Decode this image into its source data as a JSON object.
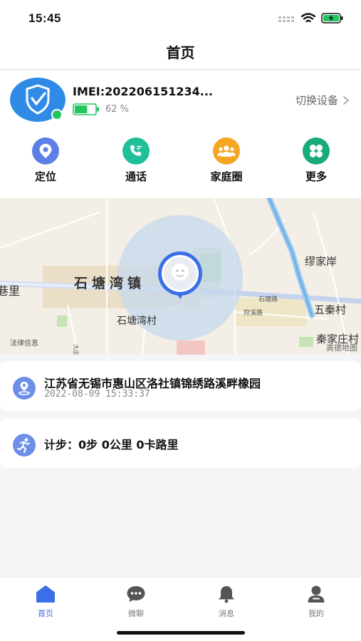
{
  "status_bar": {
    "time": "15:45"
  },
  "nav": {
    "title": "首页"
  },
  "device": {
    "imei": "IMEI:202206151234...",
    "battery_percent_text": "62 %",
    "battery_level": 0.62,
    "switch_label": "切换设备"
  },
  "quick_actions": [
    {
      "label": "定位",
      "icon": "location-pin-icon",
      "color": "#5b7fe6"
    },
    {
      "label": "通话",
      "icon": "phone-call-icon",
      "color": "#1fbf9a"
    },
    {
      "label": "家庭圈",
      "icon": "family-group-icon",
      "color": "#f5a623"
    },
    {
      "label": "更多",
      "icon": "more-grid-icon",
      "color": "#1aab7a"
    }
  ],
  "map": {
    "labels": {
      "town": "石塘湾镇",
      "village": "石塘湾村",
      "left_edge": "巷里",
      "miaojiaan": "缪家岸",
      "wuqin": "五秦村",
      "qinjiazhuang": "秦家庄村",
      "road1": "石塘路",
      "road2": "狩溪路",
      "road3": "大庄路",
      "legal": "法律信息",
      "provider": "高德地图"
    }
  },
  "location": {
    "address": "江苏省无锡市惠山区洛社镇锦绣路溪畔橡园",
    "time": "2022-08-09 15:33:37"
  },
  "steps": {
    "text": "计步：0步 0公里 0卡路里"
  },
  "tabs": [
    {
      "label": "首页",
      "icon": "home-icon",
      "active": true
    },
    {
      "label": "微聊",
      "icon": "chat-bubble-icon",
      "active": false
    },
    {
      "label": "消息",
      "icon": "bell-icon",
      "active": false
    },
    {
      "label": "我的",
      "icon": "profile-icon",
      "active": false
    }
  ],
  "colors": {
    "accent": "#3a6fe8",
    "battery_green": "#22c55e",
    "online_green": "#22c55e"
  }
}
